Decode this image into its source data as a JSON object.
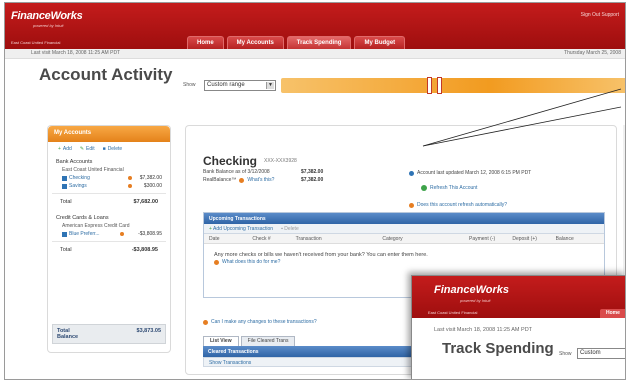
{
  "header": {
    "logo": "FinanceWorks",
    "logo_sub": "powered by Intuit",
    "bank": "East Coast United Financial",
    "links": "Sign Out Support",
    "tabs": [
      "Home",
      "My Accounts",
      "Track Spending",
      "My Budget"
    ]
  },
  "subbar": {
    "last_visit": "Last visit March 18, 2008 11:25 AM PDT",
    "date": "Thursday March 25, 2008"
  },
  "page": {
    "title": "Account Activity",
    "show_label": "Show",
    "range_value": "Custom range"
  },
  "my_accounts": {
    "title": "My Accounts",
    "actions": [
      "Add",
      "Edit",
      "Delete"
    ],
    "bank_section": "Bank Accounts",
    "bank_institution": "East Coast United Financial",
    "bank_accounts": [
      {
        "name": "Checking",
        "amount": "$7,382.00"
      },
      {
        "name": "Savings",
        "amount": "$300.00"
      }
    ],
    "bank_total_label": "Total",
    "bank_total": "$7,682.00",
    "credit_section": "Credit Cards & Loans",
    "credit_institution": "American Express Credit Card",
    "credit_accounts": [
      {
        "name": "Blue Preferr...",
        "amount": "-$3,808.95"
      }
    ],
    "credit_total_label": "Total",
    "credit_total": "-$3,808.95",
    "grand_label": "Total Balance",
    "grand_total": "$3,873.05"
  },
  "account": {
    "title": "Checking",
    "number": "XXX-XXX3928",
    "bank_balance_label": "Bank Balance as of 3/12/2008",
    "bank_balance": "$7,382.00",
    "real_balance_label": "RealBalance™",
    "whats_this": "What's this?",
    "real_balance": "$7,382.00",
    "updated": "Account last updated March 12, 2008 6:15 PM PDT",
    "refresh": "Refresh This Account",
    "automate": "Does this account refresh automatically?"
  },
  "upcoming": {
    "title": "Upcoming Transactions",
    "add": "Add Upcoming Transaction",
    "delete": "Delete",
    "columns": [
      "Date",
      "Check #",
      "Transaction",
      "Category",
      "Payment (-)",
      "Deposit (+)",
      "Balance"
    ],
    "message": "Any more checks or bills we haven't received from your bank? You can enter them here.",
    "link": "What does this do for me?"
  },
  "categories_link": "Can I make any changes to these transactions?",
  "view_tabs": [
    "List View",
    "File Cleared Trans"
  ],
  "cleared": {
    "title": "Cleared Transactions",
    "sub": "Show Transactions"
  },
  "inset": {
    "logo": "FinanceWorks",
    "logo_sub": "powered by Intuit",
    "bank": "East Coast United Financial",
    "tab": "Home",
    "last": "Last visit  March 18, 2008 11:25 AM PDT",
    "title": "Track Spending",
    "show": "Show",
    "select": "Custom"
  }
}
